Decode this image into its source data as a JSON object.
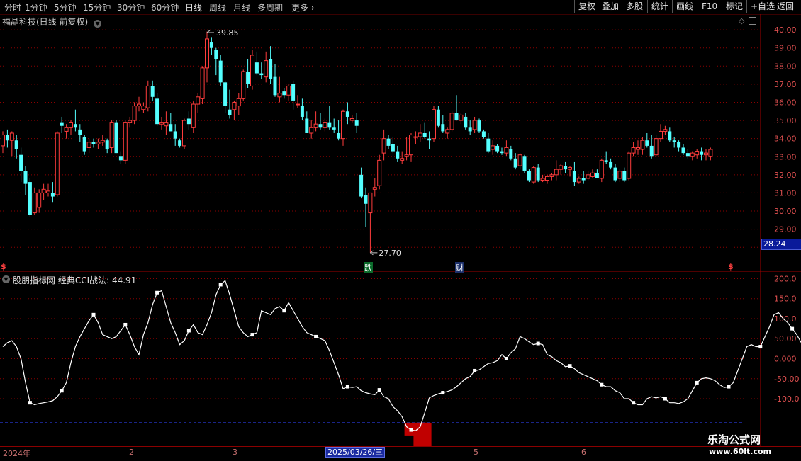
{
  "toolbar": {
    "periods": [
      "分时",
      "1分钟",
      "5分钟",
      "15分钟",
      "30分钟",
      "60分钟",
      "日线",
      "周线",
      "月线",
      "多周期",
      "更多"
    ],
    "active_period": "日线",
    "right_buttons": [
      "复权",
      "叠加",
      "多股",
      "统计",
      "画线",
      "F10",
      "标记",
      "+自选",
      "返回"
    ]
  },
  "stock": {
    "title": "福晶科技(日线 前复权)",
    "high_label": "39.85",
    "low_label": "27.70",
    "current_price_tag": "28.24",
    "price_axis": [
      "40.00",
      "39.00",
      "38.00",
      "37.00",
      "36.00",
      "35.00",
      "34.00",
      "33.00",
      "32.00",
      "31.00",
      "30.00",
      "29.00",
      "28.00"
    ],
    "event_markers": {
      "drop": "跌",
      "finance": "财",
      "dividend_left": "$",
      "dividend_right": "$"
    }
  },
  "indicator": {
    "title": "股朋指标网 经典CCI战法: 44.91",
    "axis": [
      "200.0",
      "150.0",
      "100.0",
      "50.00",
      "0.000",
      "-50.00",
      "-100.0"
    ]
  },
  "date_axis": {
    "labels": [
      "2024年",
      "2",
      "3",
      "5",
      "6"
    ],
    "cursor_date": "2025/03/26/三"
  },
  "watermark": {
    "brand": "乐淘公式网",
    "url": "www.60lt.com"
  },
  "colors": {
    "up": "#ff3c3c",
    "down": "#54ffff",
    "cci_line": "#ffffff",
    "grid": "#8b0000",
    "signal_bar": "#c00000",
    "threshold": "#2a3bd8"
  },
  "chart_data": [
    {
      "type": "candlestick",
      "title": "福晶科技(日线 前复权)",
      "ylim": [
        27.5,
        40.2
      ],
      "annotations": [
        {
          "label": "39.85",
          "value": 39.85
        },
        {
          "label": "27.70",
          "value": 27.7
        }
      ],
      "ohlc": [
        [
          33.6,
          34.4,
          33.2,
          34.2
        ],
        [
          34.2,
          34.5,
          33.5,
          33.9
        ],
        [
          33.9,
          34.4,
          33.0,
          34.3
        ],
        [
          33.9,
          34.2,
          32.9,
          33.4
        ],
        [
          33.1,
          33.5,
          31.6,
          32.2
        ],
        [
          32.2,
          32.5,
          30.9,
          31.5
        ],
        [
          31.6,
          31.8,
          29.7,
          29.8
        ],
        [
          29.9,
          31.3,
          29.8,
          31.0
        ],
        [
          30.2,
          31.2,
          29.9,
          31.0
        ],
        [
          31.0,
          31.5,
          30.6,
          31.2
        ],
        [
          31.0,
          31.5,
          30.8,
          31.1
        ],
        [
          31.0,
          31.6,
          30.5,
          30.8
        ],
        [
          30.9,
          34.4,
          30.8,
          34.3
        ],
        [
          34.9,
          35.2,
          34.3,
          34.7
        ],
        [
          34.4,
          34.8,
          34.0,
          34.6
        ],
        [
          34.6,
          35.0,
          34.2,
          34.9
        ],
        [
          34.8,
          35.6,
          34.4,
          34.6
        ],
        [
          34.5,
          34.8,
          33.8,
          34.2
        ],
        [
          34.1,
          34.2,
          33.1,
          33.3
        ],
        [
          33.5,
          34.0,
          33.2,
          33.8
        ],
        [
          33.8,
          34.0,
          33.5,
          33.7
        ],
        [
          33.7,
          34.0,
          33.4,
          33.8
        ],
        [
          33.8,
          34.2,
          33.6,
          33.9
        ],
        [
          33.9,
          34.0,
          33.2,
          33.4
        ],
        [
          33.5,
          35.0,
          33.2,
          34.9
        ],
        [
          34.9,
          35.0,
          33.2,
          33.2
        ],
        [
          33.0,
          33.3,
          32.6,
          32.8
        ],
        [
          32.8,
          35.0,
          32.6,
          34.9
        ],
        [
          34.9,
          35.2,
          34.6,
          35.0
        ],
        [
          35.0,
          36.0,
          34.8,
          35.8
        ],
        [
          35.8,
          36.3,
          35.5,
          35.9
        ],
        [
          35.6,
          36.0,
          35.4,
          35.8
        ],
        [
          35.7,
          37.2,
          35.5,
          36.9
        ],
        [
          36.9,
          37.2,
          36.1,
          36.3
        ],
        [
          36.2,
          36.5,
          34.7,
          34.8
        ],
        [
          34.8,
          35.2,
          34.5,
          34.9
        ],
        [
          34.7,
          35.5,
          34.2,
          34.9
        ],
        [
          34.8,
          35.4,
          34.4,
          34.4
        ],
        [
          34.4,
          34.8,
          33.6,
          34.0
        ],
        [
          33.9,
          34.0,
          33.5,
          33.6
        ],
        [
          33.6,
          35.1,
          33.4,
          35.0
        ],
        [
          35.1,
          35.5,
          34.5,
          34.8
        ],
        [
          34.6,
          36.1,
          34.3,
          35.9
        ],
        [
          35.9,
          36.5,
          35.4,
          36.3
        ],
        [
          36.2,
          38.0,
          35.9,
          37.9
        ],
        [
          37.9,
          39.9,
          37.1,
          39.5
        ],
        [
          39.3,
          39.6,
          38.6,
          39.0
        ],
        [
          38.9,
          39.0,
          37.5,
          38.4
        ],
        [
          38.3,
          38.6,
          36.9,
          37.1
        ],
        [
          37.1,
          37.2,
          35.4,
          35.8
        ],
        [
          35.6,
          36.7,
          35.1,
          35.3
        ],
        [
          35.6,
          36.1,
          35.0,
          36.0
        ],
        [
          35.8,
          36.5,
          35.3,
          36.2
        ],
        [
          36.2,
          37.8,
          36.1,
          37.7
        ],
        [
          37.7,
          38.4,
          36.8,
          37.0
        ],
        [
          36.9,
          38.9,
          36.7,
          38.6
        ],
        [
          38.2,
          38.8,
          37.5,
          37.6
        ],
        [
          37.6,
          38.2,
          37.3,
          37.5
        ],
        [
          37.4,
          38.8,
          37.1,
          38.3
        ],
        [
          38.4,
          39.1,
          37.0,
          37.3
        ],
        [
          37.4,
          38.1,
          36.3,
          36.4
        ],
        [
          36.3,
          37.4,
          36.0,
          36.5
        ],
        [
          36.6,
          36.8,
          36.2,
          36.4
        ],
        [
          36.4,
          37.0,
          36.1,
          36.9
        ],
        [
          37.0,
          37.2,
          35.6,
          36.1
        ],
        [
          35.9,
          36.4,
          35.7,
          35.9
        ],
        [
          35.8,
          36.2,
          35.0,
          35.2
        ],
        [
          35.1,
          35.5,
          34.3,
          34.3
        ],
        [
          34.3,
          35.0,
          34.0,
          34.6
        ],
        [
          34.6,
          35.5,
          34.4,
          34.8
        ],
        [
          34.8,
          35.4,
          34.5,
          34.6
        ],
        [
          34.6,
          35.1,
          34.4,
          34.9
        ],
        [
          34.9,
          35.8,
          34.5,
          34.6
        ],
        [
          34.6,
          35.1,
          34.3,
          34.5
        ],
        [
          34.3,
          35.0,
          33.9,
          34.0
        ],
        [
          34.0,
          35.6,
          33.6,
          35.5
        ],
        [
          35.5,
          36.0,
          34.8,
          35.2
        ],
        [
          35.0,
          35.3,
          34.9,
          35.1
        ],
        [
          35.0,
          35.4,
          34.3,
          34.7
        ],
        [
          32.0,
          32.4,
          30.7,
          30.8
        ],
        [
          30.9,
          31.3,
          29.1,
          30.4
        ],
        [
          29.9,
          31.0,
          27.7,
          31.0
        ],
        [
          31.2,
          31.8,
          30.8,
          31.3
        ],
        [
          31.4,
          33.1,
          31.2,
          32.8
        ],
        [
          33.2,
          34.5,
          32.8,
          34.0
        ],
        [
          34.0,
          34.2,
          33.4,
          33.6
        ],
        [
          33.7,
          34.1,
          33.2,
          33.3
        ],
        [
          33.3,
          33.6,
          32.7,
          32.9
        ],
        [
          32.8,
          33.3,
          32.6,
          32.9
        ],
        [
          33.0,
          34.1,
          32.8,
          33.1
        ],
        [
          33.1,
          34.3,
          32.7,
          34.2
        ],
        [
          34.1,
          34.4,
          33.7,
          34.1
        ],
        [
          34.1,
          34.8,
          33.8,
          34.3
        ],
        [
          34.3,
          34.9,
          34.0,
          34.1
        ],
        [
          34.0,
          34.4,
          33.4,
          33.9
        ],
        [
          34.0,
          35.8,
          33.8,
          35.6
        ],
        [
          35.6,
          35.8,
          34.6,
          34.7
        ],
        [
          34.8,
          35.3,
          34.3,
          34.4
        ],
        [
          34.3,
          34.6,
          34.0,
          34.5
        ],
        [
          34.5,
          35.5,
          34.4,
          35.4
        ],
        [
          35.4,
          36.4,
          35.2,
          35.0
        ],
        [
          35.0,
          35.4,
          34.8,
          35.3
        ],
        [
          35.2,
          35.4,
          34.5,
          34.6
        ],
        [
          34.6,
          35.0,
          34.2,
          34.4
        ],
        [
          34.5,
          35.2,
          34.3,
          35.0
        ],
        [
          35.0,
          35.1,
          34.3,
          34.4
        ],
        [
          34.4,
          34.5,
          34.0,
          34.1
        ],
        [
          34.0,
          34.3,
          33.2,
          33.3
        ],
        [
          33.4,
          33.9,
          33.1,
          33.6
        ],
        [
          33.6,
          33.7,
          33.2,
          33.3
        ],
        [
          33.3,
          33.5,
          33.1,
          33.2
        ],
        [
          33.2,
          33.9,
          33.0,
          33.5
        ],
        [
          33.4,
          33.6,
          32.8,
          32.9
        ],
        [
          32.9,
          33.2,
          32.3,
          32.4
        ],
        [
          32.5,
          33.2,
          32.3,
          33.1
        ],
        [
          33.0,
          33.1,
          32.1,
          32.2
        ],
        [
          32.2,
          32.3,
          31.6,
          31.7
        ],
        [
          31.6,
          32.5,
          31.5,
          32.4
        ],
        [
          32.4,
          32.6,
          31.6,
          31.7
        ],
        [
          31.7,
          32.0,
          31.6,
          31.8
        ],
        [
          31.7,
          32.0,
          31.5,
          31.9
        ],
        [
          31.9,
          32.1,
          31.7,
          32.0
        ],
        [
          32.0,
          32.8,
          31.7,
          32.3
        ],
        [
          32.3,
          32.6,
          32.0,
          32.5
        ],
        [
          32.5,
          32.7,
          32.1,
          32.3
        ],
        [
          32.3,
          32.5,
          31.9,
          32.4
        ],
        [
          32.2,
          32.7,
          31.4,
          31.6
        ],
        [
          31.6,
          31.9,
          31.5,
          31.8
        ],
        [
          31.8,
          32.2,
          31.5,
          31.7
        ],
        [
          31.8,
          32.2,
          31.7,
          32.0
        ],
        [
          31.9,
          32.3,
          31.8,
          32.1
        ],
        [
          32.1,
          32.3,
          31.8,
          31.8
        ],
        [
          31.8,
          32.9,
          31.6,
          32.8
        ],
        [
          32.8,
          33.3,
          32.6,
          32.7
        ],
        [
          32.7,
          32.9,
          32.3,
          32.4
        ],
        [
          32.4,
          32.6,
          31.6,
          31.7
        ],
        [
          31.8,
          32.3,
          31.6,
          32.2
        ],
        [
          32.2,
          32.4,
          31.6,
          31.7
        ],
        [
          31.8,
          33.3,
          31.7,
          33.2
        ],
        [
          33.2,
          33.8,
          33.0,
          33.5
        ],
        [
          33.4,
          33.9,
          33.1,
          33.5
        ],
        [
          33.4,
          34.1,
          33.1,
          33.9
        ],
        [
          33.9,
          34.3,
          33.5,
          33.6
        ],
        [
          33.6,
          34.2,
          32.9,
          33.0
        ],
        [
          33.1,
          34.2,
          33.0,
          34.0
        ],
        [
          34.0,
          34.8,
          33.8,
          34.4
        ],
        [
          34.4,
          34.7,
          34.2,
          34.5
        ],
        [
          34.4,
          34.6,
          33.8,
          33.9
        ],
        [
          33.9,
          34.1,
          33.5,
          33.8
        ],
        [
          33.8,
          33.9,
          33.3,
          33.5
        ],
        [
          33.5,
          33.7,
          33.1,
          33.2
        ],
        [
          33.2,
          33.4,
          32.9,
          33.0
        ],
        [
          33.0,
          33.3,
          32.8,
          33.2
        ],
        [
          33.1,
          33.4,
          32.9,
          33.3
        ],
        [
          33.3,
          33.5,
          32.8,
          33.1
        ],
        [
          33.1,
          33.4,
          32.8,
          33.2
        ],
        [
          33.0,
          33.5,
          32.8,
          33.4
        ]
      ]
    },
    {
      "type": "line",
      "title": "股朋指标网 经典CCI战法: 44.91",
      "ylim": [
        -215,
        215
      ],
      "series": [
        {
          "name": "经典CCI战法",
          "values": [
            30,
            40,
            45,
            30,
            0,
            -60,
            -110,
            -115,
            -112,
            -110,
            -108,
            -105,
            -95,
            -80,
            -60,
            -10,
            30,
            55,
            75,
            95,
            110,
            90,
            60,
            55,
            50,
            55,
            70,
            85,
            60,
            30,
            10,
            60,
            90,
            135,
            165,
            170,
            130,
            90,
            65,
            35,
            45,
            70,
            85,
            65,
            60,
            85,
            115,
            160,
            185,
            195,
            160,
            120,
            80,
            65,
            55,
            60,
            65,
            120,
            115,
            110,
            125,
            130,
            120,
            140,
            120,
            100,
            80,
            65,
            60,
            55,
            50,
            45,
            20,
            -10,
            -40,
            -75,
            -70,
            -72,
            -70,
            -80,
            -85,
            -88,
            -90,
            -78,
            -95,
            -100,
            -120,
            -130,
            -145,
            -170,
            -178,
            -180,
            -170,
            -135,
            -98,
            -92,
            -88,
            -85,
            -82,
            -78,
            -70,
            -60,
            -50,
            -45,
            -30,
            -28,
            -20,
            -12,
            -10,
            -5,
            10,
            0,
            15,
            25,
            55,
            50,
            42,
            35,
            38,
            35,
            10,
            5,
            -5,
            -10,
            -20,
            -18,
            -25,
            -35,
            -40,
            -45,
            -50,
            -55,
            -65,
            -70,
            -70,
            -80,
            -85,
            -100,
            -100,
            -110,
            -115,
            -115,
            -100,
            -95,
            -98,
            -95,
            -100,
            -110,
            -110,
            -112,
            -108,
            -100,
            -80,
            -60,
            -50,
            -48,
            -50,
            -55,
            -65,
            -72,
            -70,
            -60,
            -30,
            0,
            30,
            35,
            30,
            30,
            55,
            80,
            110,
            115,
            100,
            90,
            75,
            60,
            40,
            38,
            40,
            35,
            45
          ]
        }
      ],
      "threshold": -160,
      "signal_bars": [
        {
          "bar_start": 89,
          "bar_end": 93,
          "depth": 1
        },
        {
          "bar_start": 91,
          "bar_end": 94,
          "depth": 2
        },
        {
          "bar_start": 92,
          "bar_end": 93,
          "depth": 3
        }
      ],
      "marker_every": 7
    }
  ]
}
